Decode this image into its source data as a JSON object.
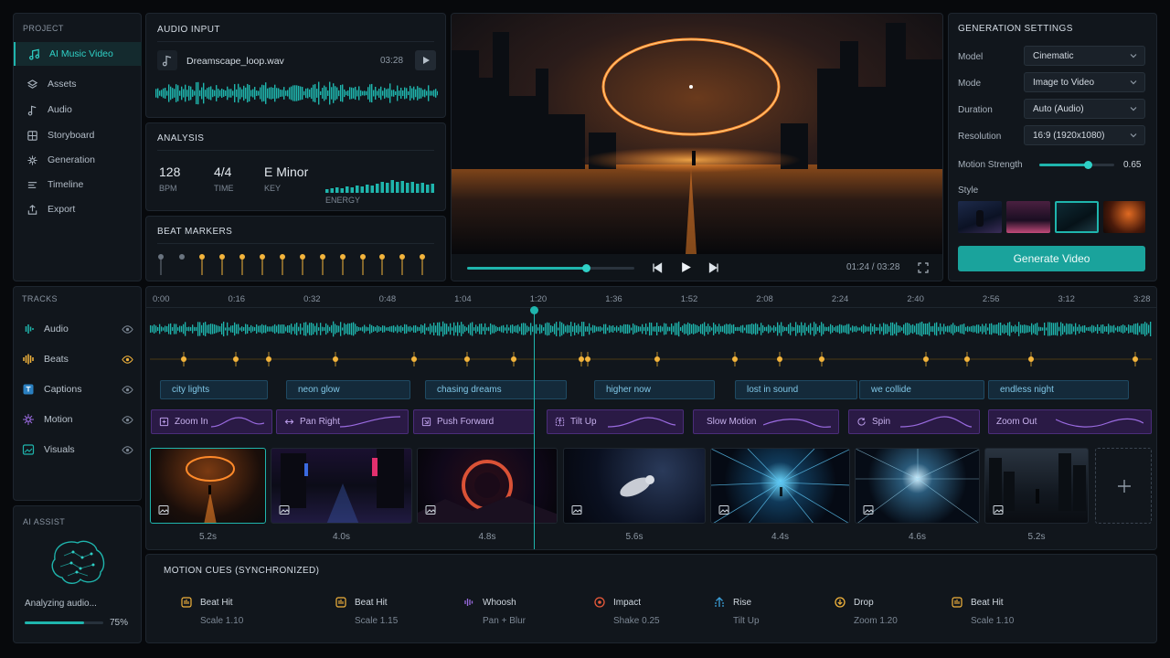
{
  "sidebar": {
    "section": "PROJECT",
    "items": [
      {
        "label": "AI Music Video",
        "icon": "music-note-icon",
        "active": true
      },
      {
        "label": "Assets",
        "icon": "layers-icon"
      },
      {
        "label": "Audio",
        "icon": "note-icon"
      },
      {
        "label": "Storyboard",
        "icon": "storyboard-icon"
      },
      {
        "label": "Generation",
        "icon": "sparkle-icon"
      },
      {
        "label": "Timeline",
        "icon": "timeline-icon"
      },
      {
        "label": "Export",
        "icon": "export-icon"
      }
    ]
  },
  "audio_input": {
    "title": "AUDIO INPUT",
    "file": "Dreamscape_loop.wav",
    "duration": "03:28"
  },
  "analysis": {
    "title": "ANALYSIS",
    "bpm": "128",
    "bpm_label": "BPM",
    "time": "4/4",
    "time_label": "TIME",
    "key": "E Minor",
    "key_label": "KEY",
    "energy_label": "ENERGY"
  },
  "beat_markers": {
    "title": "BEAT MARKERS"
  },
  "preview": {
    "time": "01:24 / 03:28",
    "progress": 0.71
  },
  "generation": {
    "title": "GENERATION SETTINGS",
    "model_label": "Model",
    "model": "Cinematic",
    "mode_label": "Mode",
    "mode": "Image to Video",
    "duration_label": "Duration",
    "duration": "Auto (Audio)",
    "resolution_label": "Resolution",
    "resolution": "16:9 (1920x1080)",
    "motion_label": "Motion Strength",
    "motion_value": "0.65",
    "motion_level": 0.65,
    "style_label": "Style",
    "button": "Generate Video"
  },
  "tracks": {
    "title": "TRACKS",
    "items": [
      {
        "label": "Audio",
        "icon": "audio-wave-icon",
        "color": "#1fb5ad"
      },
      {
        "label": "Beats",
        "icon": "beats-icon",
        "color": "#f3b43c"
      },
      {
        "label": "Captions",
        "icon": "caption-icon",
        "color": "#3b9fd8"
      },
      {
        "label": "Motion",
        "icon": "motion-icon",
        "color": "#9a6be0"
      },
      {
        "label": "Visuals",
        "icon": "visuals-icon",
        "color": "#1fb5ad"
      }
    ]
  },
  "timeline": {
    "ticks": [
      "0:00",
      "0:16",
      "0:32",
      "0:48",
      "1:04",
      "1:20",
      "1:36",
      "1:52",
      "2:08",
      "2:24",
      "2:40",
      "2:56",
      "3:12",
      "3:28"
    ],
    "captions": [
      "city lights",
      "neon glow",
      "chasing dreams",
      "higher now",
      "lost in sound",
      "we collide",
      "endless night"
    ],
    "motions": [
      "Zoom In",
      "Pan Right",
      "Push Forward",
      "Tilt Up",
      "Slow Motion",
      "Spin",
      "Zoom Out"
    ],
    "durations": [
      "5.2s",
      "4.0s",
      "4.8s",
      "5.6s",
      "4.4s",
      "4.6s",
      "5.2s"
    ]
  },
  "ai_assist": {
    "title": "AI ASSIST",
    "status": "Analyzing audio...",
    "percent": "75%",
    "level": 0.75
  },
  "motion_cues": {
    "title": "MOTION CUES (SYNCHRONIZED)",
    "items": [
      {
        "name": "Beat Hit",
        "sub": "Scale 1.10",
        "color": "#f3b43c"
      },
      {
        "name": "Beat Hit",
        "sub": "Scale 1.15",
        "color": "#f3b43c"
      },
      {
        "name": "Whoosh",
        "sub": "Pan + Blur",
        "color": "#9a6be0"
      },
      {
        "name": "Impact",
        "sub": "Shake 0.25",
        "color": "#e8593a"
      },
      {
        "name": "Rise",
        "sub": "Tilt Up",
        "color": "#3b9fd8"
      },
      {
        "name": "Drop",
        "sub": "Zoom 1.20",
        "color": "#f3b43c"
      },
      {
        "name": "Beat Hit",
        "sub": "Scale 1.10",
        "color": "#f3b43c"
      }
    ]
  }
}
